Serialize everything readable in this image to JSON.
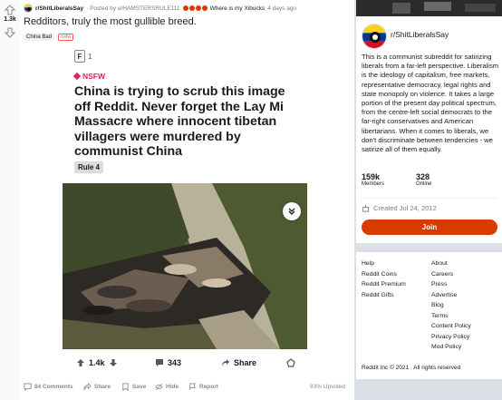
{
  "post": {
    "score": "1.3k",
    "subreddit": "r/ShitLiberalsSay",
    "posted_by": "· Posted by u/HAMSTERSRULE111",
    "author_title": "Where is my Xibucks",
    "age": "4 days ago",
    "title": "Redditors, truly the most gullible breed.",
    "flair": "China Bad",
    "nsfw_flair": "nsfw",
    "footer": {
      "comments": "84 Comments",
      "share": "Share",
      "save": "Save",
      "hide": "Hide",
      "report": "Report",
      "upvoted": "93% Upvoted"
    }
  },
  "embed": {
    "award_count": "1",
    "award_letter": "F",
    "nsfw_label": "NSFW",
    "title": "China is trying to scrub this image off Reddit. Never forget the Lay Mi Massacre where innocent tibetan villagers were murdered by communist China",
    "rule_tag": "Rule 4",
    "votes": "1.4k",
    "comments": "343",
    "share": "Share"
  },
  "sidebar": {
    "subreddit": "r/ShitLiberalsSay",
    "description": "This is a communist subreddit for satirizing liberals from a far-left perspective. Liberalism is the ideology of capitalism, free markets, representative democracy, legal rights and state monopoly on violence. It takes a large portion of the present day political spectrum, from the centre-left social democrats to the far-right conservatives and American libertarians. When it comes to liberals, we don't discriminate between tendencies - we satirize all of them equally.",
    "members_count": "159k",
    "members_label": "Members",
    "online_count": "328",
    "online_label": "Online",
    "created": "Created Jul 24, 2012",
    "join_label": "Join",
    "links_left": [
      "Help",
      "Reddit Coins",
      "Reddit Premium",
      "Reddit Gifts"
    ],
    "links_right": [
      "About",
      "Careers",
      "Press",
      "Advertise",
      "Blog",
      "Terms",
      "Content Policy",
      "Privacy Policy",
      "Mod Policy"
    ],
    "copyright": "Reddit Inc © 2021 . All rights reserved"
  },
  "colors": {
    "join": "#d93a00",
    "nsfw": "#e0245e",
    "page_bg": "#dae0e6"
  }
}
